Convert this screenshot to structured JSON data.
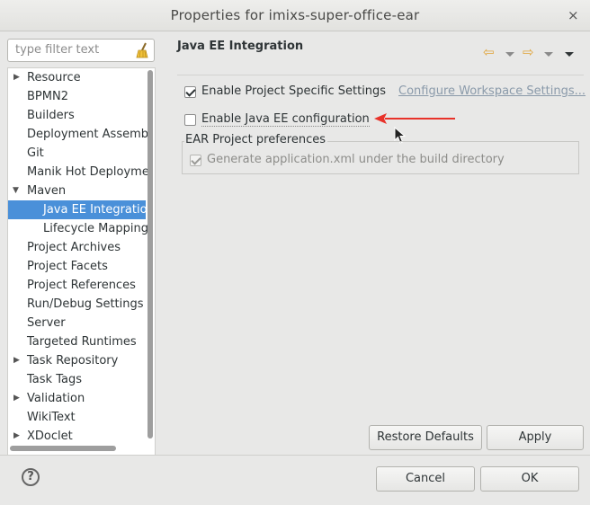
{
  "window": {
    "title": "Properties for imixs-super-office-ear",
    "close_glyph": "×"
  },
  "filter": {
    "placeholder": "type filter text"
  },
  "tree": {
    "items": [
      {
        "label": "Resource",
        "expander": "▶"
      },
      {
        "label": "BPMN2"
      },
      {
        "label": "Builders"
      },
      {
        "label": "Deployment Assemb"
      },
      {
        "label": "Git"
      },
      {
        "label": "Manik Hot Deployme"
      },
      {
        "label": "Maven",
        "expander": "▼"
      },
      {
        "label": "Java EE Integratio",
        "selected": true,
        "child": true
      },
      {
        "label": "Lifecycle Mapping",
        "child": true
      },
      {
        "label": "Project Archives"
      },
      {
        "label": "Project Facets"
      },
      {
        "label": "Project References"
      },
      {
        "label": "Run/Debug Settings"
      },
      {
        "label": "Server"
      },
      {
        "label": "Targeted Runtimes"
      },
      {
        "label": "Task Repository",
        "expander": "▶"
      },
      {
        "label": "Task Tags"
      },
      {
        "label": "Validation",
        "expander": "▶"
      },
      {
        "label": "WikiText"
      },
      {
        "label": "XDoclet",
        "expander": "▶"
      }
    ]
  },
  "page": {
    "title": "Java EE Integration",
    "nav_back_glyph": "⇦",
    "nav_forward_glyph": "⇨",
    "enable_project_specific": {
      "label": "Enable Project Specific Settings",
      "checked": true
    },
    "configure_workspace_link": "Configure Workspace Settings...",
    "enable_javaee": {
      "label": "Enable Java EE configuration",
      "checked": false
    },
    "group": {
      "title": "EAR Project preferences",
      "generate_appxml": {
        "label": "Generate application.xml under the build directory",
        "checked": true,
        "enabled": false
      }
    },
    "restore_defaults_label": "Restore Defaults",
    "apply_label": "Apply"
  },
  "dialog": {
    "cancel_label": "Cancel",
    "ok_label": "OK",
    "help_glyph": "?"
  },
  "colors": {
    "selection": "#4a90d9",
    "annotation_arrow": "#e8322a",
    "nav_arrow": "#e0a43a"
  }
}
